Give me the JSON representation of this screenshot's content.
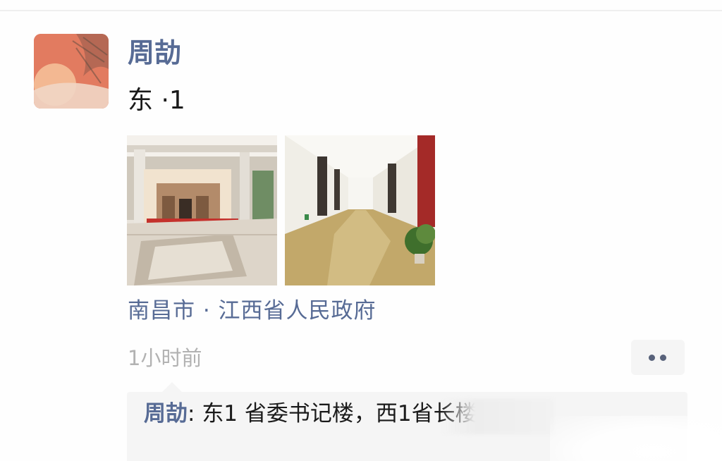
{
  "moment": {
    "username": "周劼",
    "text": "东 ·1",
    "location": "南昌市 · 江西省人民政府",
    "timestamp": "1小时前"
  },
  "comments": [
    {
      "author": "周劼",
      "separator": ": ",
      "text": "东1 省委书记楼，西1省长楼"
    }
  ],
  "colors": {
    "link": "#576b95",
    "text": "#1a1a1a",
    "muted": "#b2b2b2",
    "comment_bg": "#f5f5f5"
  },
  "icons": {
    "more": "more-dots-icon",
    "avatar": "avatar-image"
  }
}
